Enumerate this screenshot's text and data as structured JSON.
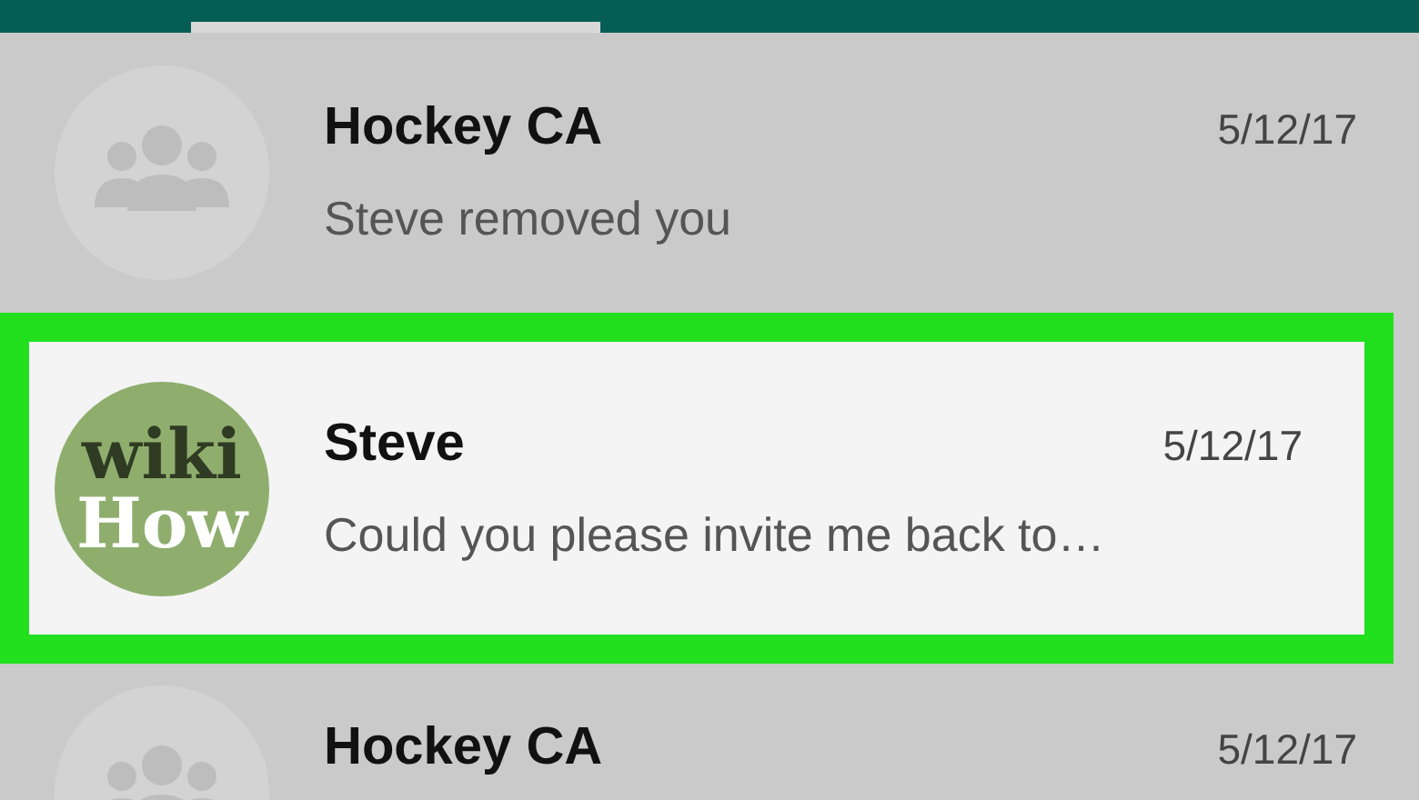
{
  "chats": [
    {
      "name": "Hockey CA",
      "date": "5/12/17",
      "preview": "Steve removed you",
      "selected": false,
      "avatar": {
        "kind": "group"
      }
    },
    {
      "name": "Steve",
      "date": "5/12/17",
      "preview": "Could you please invite me back to…",
      "selected": true,
      "avatar": {
        "kind": "text",
        "lines": [
          "wiki",
          "How"
        ]
      }
    },
    {
      "name": "Hockey CA",
      "date": "5/12/17",
      "selected": false,
      "avatar": {
        "kind": "group"
      }
    }
  ]
}
